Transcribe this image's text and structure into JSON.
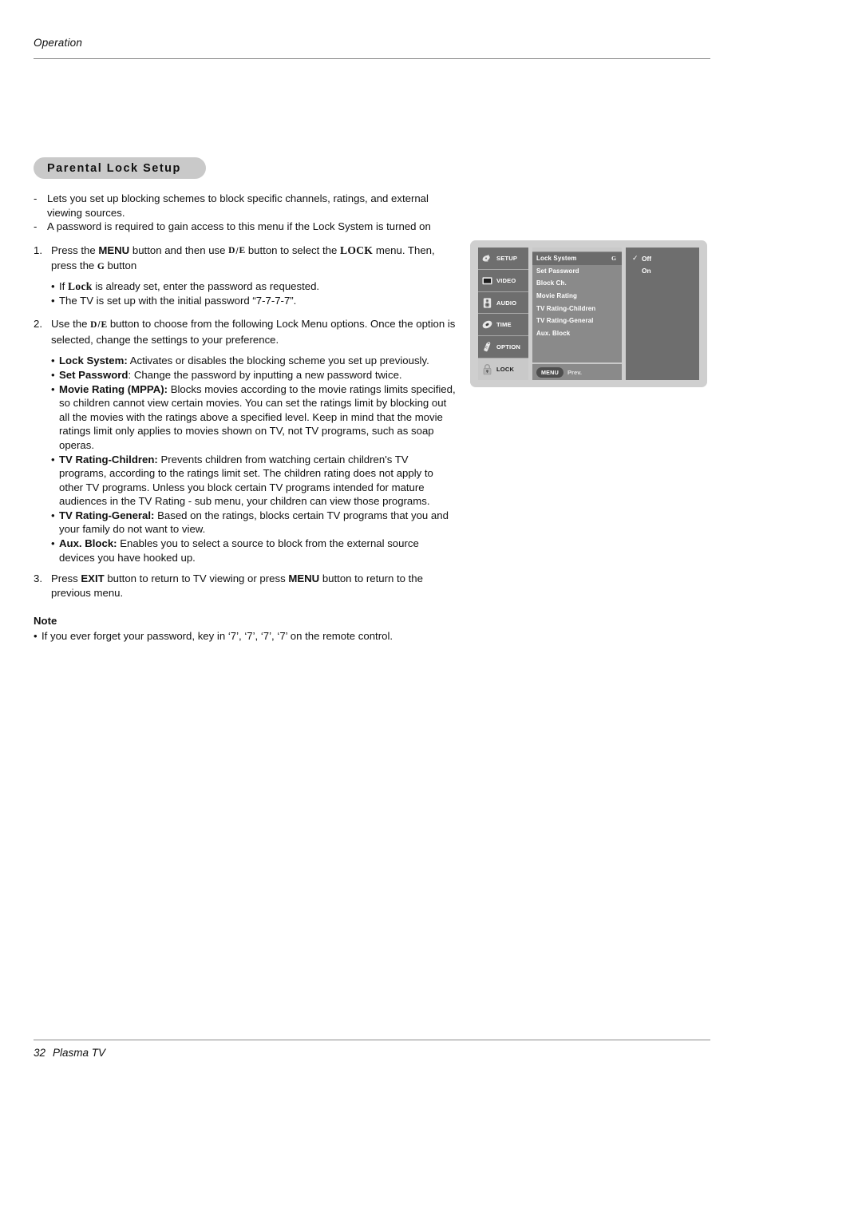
{
  "header": {
    "running_head": "Operation"
  },
  "section": {
    "title": "Parental Lock Setup"
  },
  "intro": {
    "dash": "-",
    "items": [
      "Lets you set up blocking schemes to block specific channels, ratings, and external viewing sources.",
      "A password is required to gain access to this menu if the Lock System is turned on"
    ]
  },
  "keys": {
    "up": "D",
    "down": "E",
    "sep": "/",
    "ok": "G",
    "menu": "MENU",
    "exit": "EXIT",
    "lock": "LOCK"
  },
  "steps": {
    "one": {
      "number": "1.",
      "part1": "Press the ",
      "menu_bold": "MENU",
      "part2": " button and then use ",
      "part3": " button to select the ",
      "part4": " menu. Then, press the ",
      "part5": " button"
    },
    "one_bullets": {
      "bullet": "•",
      "b1_pre": "If ",
      "b1_bold": "Lock",
      "b1_post": " is already set, enter the password as requested.",
      "b2": "The TV is set up with the initial password “7-7-7-7”."
    },
    "two": {
      "number": "2.",
      "part1": "Use the ",
      "part2": " button to choose from the following Lock Menu options. Once the option is selected, change the settings to your preference."
    },
    "three": {
      "number": "3.",
      "part1": "Press ",
      "exit_bold": "EXIT",
      "part2": " button to return to TV viewing or press ",
      "menu_bold": "MENU",
      "part3": " button to return to the previous menu."
    }
  },
  "options": {
    "bullet": "•",
    "items": [
      {
        "term": "Lock System:",
        "desc": " Activates or disables the blocking scheme you set up previously."
      },
      {
        "term": "Set Password",
        "desc": ": Change the password by inputting a new password twice."
      },
      {
        "term": "Movie Rating (MPPA):",
        "desc": " Blocks movies according to the movie ratings limits specified, so children cannot view certain movies. You can set the ratings limit by blocking out all the movies with the ratings above a specified level. Keep in mind that the movie ratings limit only applies to movies shown on TV, not TV programs, such as soap operas."
      },
      {
        "term": "TV Rating-Children:",
        "desc": " Prevents children from watching certain children's TV programs, according to the ratings limit set. The children rating does not apply to other TV programs. Unless you block certain TV programs intended for mature audiences in the TV Rating - sub menu, your children can view those programs."
      },
      {
        "term": "TV Rating-General:",
        "desc": " Based on the ratings, blocks certain TV programs that you and your family do not want to view."
      },
      {
        "term": "Aux. Block:",
        "desc": " Enables you to select a source to block from the external source devices you have hooked up."
      }
    ]
  },
  "note": {
    "title": "Note",
    "bullet": "•",
    "text": "If you ever forget your password, key in ‘7’, ‘7’, ‘7’, ‘7’ on the remote control."
  },
  "osd": {
    "icon_menu": [
      {
        "label": "SETUP",
        "icon": "satellite-dish-icon",
        "active": false
      },
      {
        "label": "VIDEO",
        "icon": "tv-screen-icon",
        "active": false
      },
      {
        "label": "AUDIO",
        "icon": "speaker-icon",
        "active": false
      },
      {
        "label": "TIME",
        "icon": "clock-disc-icon",
        "active": false
      },
      {
        "label": "OPTION",
        "icon": "remote-control-icon",
        "active": false
      },
      {
        "label": "LOCK",
        "icon": "padlock-icon",
        "active": true
      }
    ],
    "rows": [
      {
        "label": "Lock System",
        "arrow": "G",
        "selected": true
      },
      {
        "label": "Set Password",
        "arrow": "",
        "selected": false
      },
      {
        "label": "Block Ch.",
        "arrow": "",
        "selected": false
      },
      {
        "label": "Movie Rating",
        "arrow": "",
        "selected": false
      },
      {
        "label": "TV Rating-Children",
        "arrow": "",
        "selected": false
      },
      {
        "label": "TV Rating-General",
        "arrow": "",
        "selected": false
      },
      {
        "label": "Aux. Block",
        "arrow": "",
        "selected": false
      }
    ],
    "footer": {
      "menu_key": "MENU",
      "prev_label": "Prev."
    },
    "right_options": [
      {
        "label": "Off",
        "check": "✓"
      },
      {
        "label": "On",
        "check": ""
      }
    ]
  },
  "footer": {
    "page_number": "32",
    "product": "Plasma TV"
  },
  "colors": {
    "pill_bg": "#c9c9c9",
    "osd_frame": "#cfcfcf",
    "osd_panel": "#6e6e6e",
    "osd_mid": "#8a8a8a",
    "osd_selected": "#6b6b6b",
    "rule": "#8a8a8a"
  }
}
